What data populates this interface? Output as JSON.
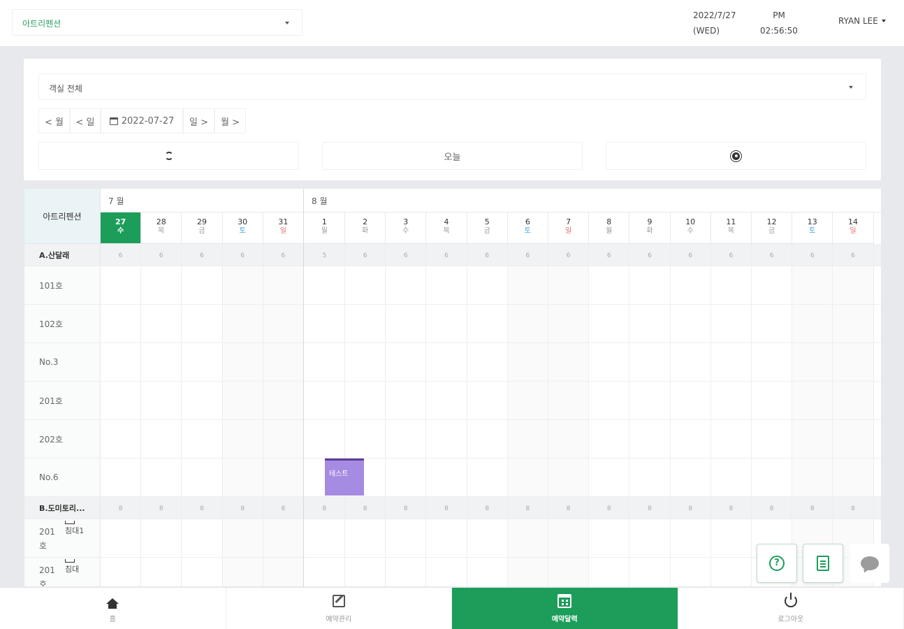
{
  "header": {
    "property_select": "아트리펜션",
    "date_line1": "2022/7/27",
    "date_line2": "(WED)",
    "ampm": "PM",
    "time": "02:56:50",
    "user": "RYAN LEE"
  },
  "filter": {
    "room_select": "객실 전체",
    "nav": {
      "prev_month": "< 월",
      "prev_day": "< 일",
      "date": "2022-07-27",
      "next_day": "일 >",
      "next_month": "월 >"
    },
    "today_label": "오늘"
  },
  "calendar": {
    "corner_label": "아트리펜션",
    "month1": "7 월",
    "month2": "8 월",
    "days": [
      {
        "d": "27",
        "w": "수"
      },
      {
        "d": "28",
        "w": "목"
      },
      {
        "d": "29",
        "w": "금"
      },
      {
        "d": "30",
        "w": "토"
      },
      {
        "d": "31",
        "w": "일"
      },
      {
        "d": "1",
        "w": "월"
      },
      {
        "d": "2",
        "w": "화"
      },
      {
        "d": "3",
        "w": "수"
      },
      {
        "d": "4",
        "w": "목"
      },
      {
        "d": "5",
        "w": "금"
      },
      {
        "d": "6",
        "w": "토"
      },
      {
        "d": "7",
        "w": "일"
      },
      {
        "d": "8",
        "w": "월"
      },
      {
        "d": "9",
        "w": "화"
      },
      {
        "d": "10",
        "w": "수"
      },
      {
        "d": "11",
        "w": "목"
      },
      {
        "d": "12",
        "w": "금"
      },
      {
        "d": "13",
        "w": "토"
      },
      {
        "d": "14",
        "w": "일"
      }
    ],
    "group_a": "A.산달래",
    "group_a_counts": [
      "6",
      "6",
      "6",
      "6",
      "6",
      "5",
      "6",
      "6",
      "6",
      "6",
      "6",
      "6",
      "6",
      "6",
      "6",
      "6",
      "6",
      "6",
      "6"
    ],
    "rooms_a": [
      "101호",
      "102호",
      "No.3",
      "201호",
      "202호",
      "No.6"
    ],
    "group_b": "B.도미토리...",
    "group_b_counts": [
      "8",
      "8",
      "8",
      "8",
      "8",
      "8",
      "8",
      "8",
      "8",
      "8",
      "8",
      "8",
      "8",
      "8",
      "8",
      "8",
      "8",
      "8",
      "8"
    ],
    "dorm_room": "201호",
    "dorm_bed1": "침대1",
    "dorm_bed2": "침대",
    "booking_label": "테스트"
  },
  "bottom_nav": {
    "home": "홈",
    "booking_mgmt": "예약관리",
    "booking_calendar": "예약달력",
    "logout": "로그아웃"
  }
}
